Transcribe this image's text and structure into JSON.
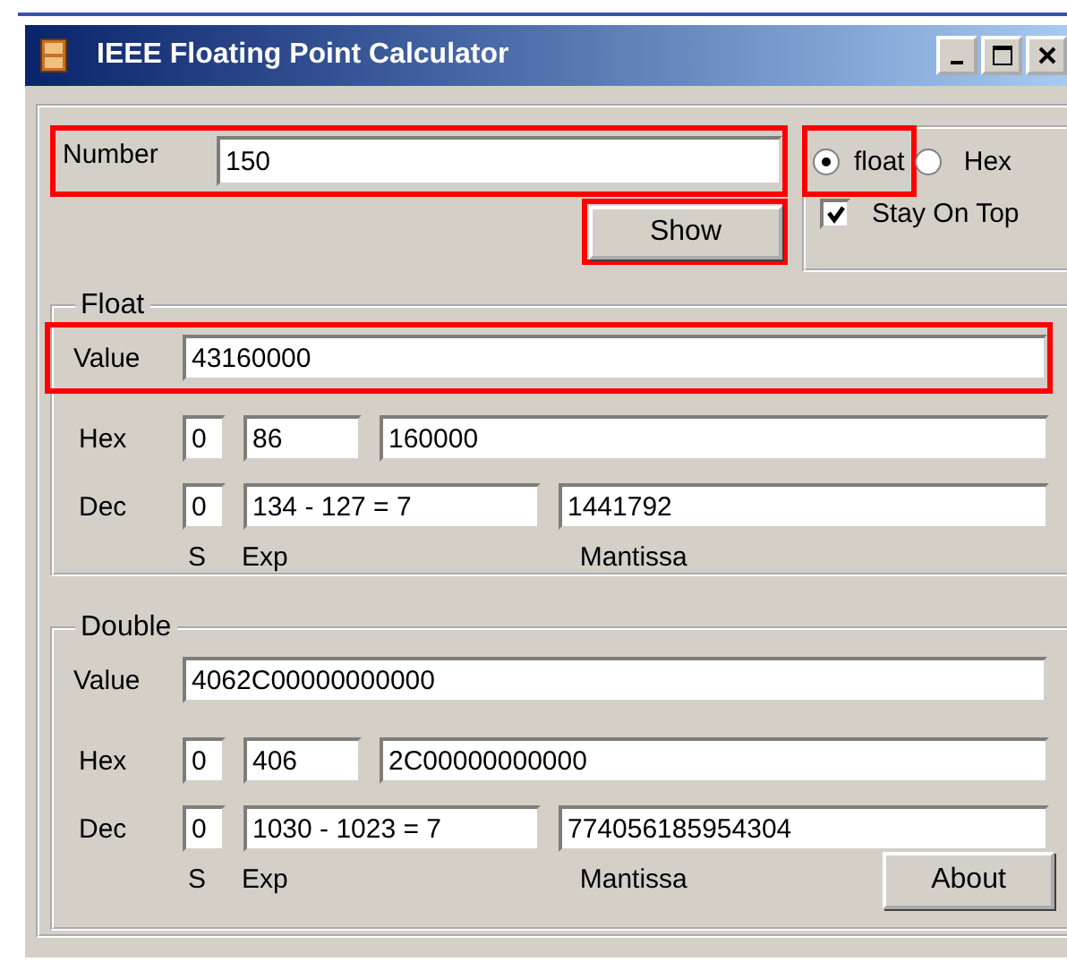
{
  "window": {
    "title": "IEEE Floating Point Calculator"
  },
  "number": {
    "label": "Number",
    "value": "150",
    "highlighted": true
  },
  "show_button": {
    "label": "Show",
    "highlighted": true
  },
  "format_options": [
    {
      "label": "float",
      "selected": true,
      "highlighted": true
    },
    {
      "label": "Hex",
      "selected": false,
      "highlighted": false
    }
  ],
  "stay_on_top": {
    "label": "Stay On Top",
    "checked": true
  },
  "sections": [
    {
      "title": "Float",
      "value_label": "Value",
      "value": "43160000",
      "highlighted": true,
      "rows": [
        {
          "label": "Hex",
          "sign": "0",
          "exponent": "86",
          "mantissa": "160000"
        },
        {
          "label": "Dec",
          "sign": "0",
          "exponent": "134 - 127 = 7",
          "mantissa": "1441792"
        }
      ],
      "column_labels": [
        "S",
        "Exp",
        "Mantissa"
      ]
    },
    {
      "title": "Double",
      "value_label": "Value",
      "value": "4062C00000000000",
      "highlighted": false,
      "rows": [
        {
          "label": "Hex",
          "sign": "0",
          "exponent": "406",
          "mantissa": "2C00000000000"
        },
        {
          "label": "Dec",
          "sign": "0",
          "exponent": "1030 - 1023 = 7",
          "mantissa": "774056185954304"
        }
      ],
      "column_labels": [
        "S",
        "Exp",
        "Mantissa"
      ]
    }
  ],
  "about_button": "About"
}
